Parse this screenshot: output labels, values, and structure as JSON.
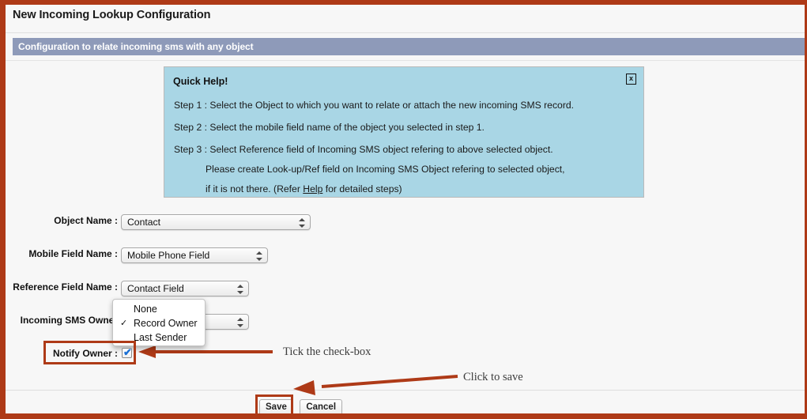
{
  "window": {
    "title": "New Incoming Lookup Configuration",
    "section_title": "Configuration to relate incoming sms with any object"
  },
  "quick_help": {
    "heading": "Quick Help!",
    "close_label": "x",
    "lines": [
      "Step 1 :  Select the Object to which you want to relate or attach the new incoming SMS record.",
      "Step 2 :  Select the mobile field name of the object you selected in step 1.",
      "Step 3 :  Select Reference field of Incoming SMS object refering to above selected object.",
      "Please create Look-up/Ref field on Incoming SMS Object refering to selected object,"
    ],
    "last_line_prefix": "if it is not there. (Refer ",
    "last_line_link": "Help",
    "last_line_suffix": " for detailed steps)"
  },
  "form": {
    "object_name": {
      "label": "Object Name :",
      "value": "Contact"
    },
    "mobile_field_name": {
      "label": "Mobile Field Name :",
      "value": "Mobile Phone Field"
    },
    "reference_field_name": {
      "label": "Reference Field Name :",
      "value": "Contact Field"
    },
    "incoming_sms_owner": {
      "label": "Incoming SMS Owner",
      "value": "Record Owner",
      "options": [
        "None",
        "Record Owner",
        "Last Sender"
      ],
      "selected_index": 1,
      "check_glyph": "✓"
    },
    "notify_owner": {
      "label": "Notify Owner :",
      "checked": true,
      "check_glyph": "✔"
    }
  },
  "footer": {
    "save_label": "Save",
    "cancel_label": "Cancel"
  },
  "annotations": {
    "tick_checkbox": "Tick the check-box",
    "click_to_save": "Click to save"
  },
  "colors": {
    "frame": "#ae3a17",
    "section_bar": "#8e9ab9",
    "quick_help_bg": "#a9d6e5",
    "annotation": "#ae3a17",
    "checkbox_tick": "#1a6fd4"
  }
}
